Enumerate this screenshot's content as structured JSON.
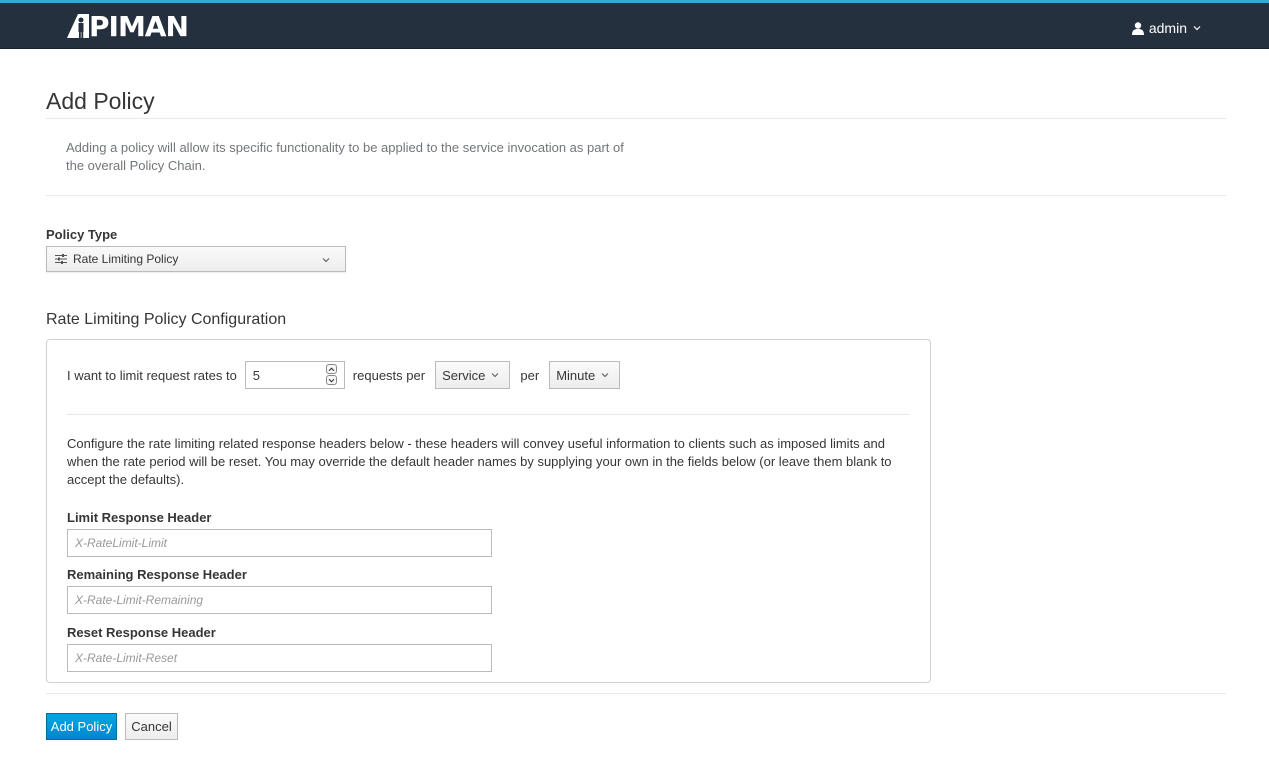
{
  "header": {
    "logo_text": "PIMAN",
    "user_name": "admin"
  },
  "page": {
    "title": "Add Policy",
    "intro": "Adding a policy will allow its specific functionality to be applied to the service invocation as part of the overall Policy Chain."
  },
  "policy_type": {
    "label": "Policy Type",
    "selected": "Rate Limiting Policy",
    "icon": "sliders-icon"
  },
  "config": {
    "title": "Rate Limiting Policy Configuration",
    "rate_prefix": "I want to limit request rates to",
    "rate_value": "5",
    "requests_per_label": "requests per",
    "granularity": "Service",
    "per_label": "per",
    "period": "Minute",
    "help_text": "Configure the rate limiting related response headers below - these headers will convey useful information to clients such as imposed limits and when the rate period will be reset. You may override the default header names by supplying your own in the fields below (or leave them blank to accept the defaults).",
    "fields": [
      {
        "label": "Limit Response Header",
        "value": "",
        "placeholder": "X-RateLimit-Limit"
      },
      {
        "label": "Remaining Response Header",
        "value": "",
        "placeholder": "X-Rate-Limit-Remaining"
      },
      {
        "label": "Reset Response Header",
        "value": "",
        "placeholder": "X-Rate-Limit-Reset"
      }
    ]
  },
  "actions": {
    "add_label": "Add Policy",
    "cancel_label": "Cancel"
  },
  "colors": {
    "navbar": "#25303f",
    "accent": "#39a5dc",
    "primary_button": "#0085cf"
  }
}
